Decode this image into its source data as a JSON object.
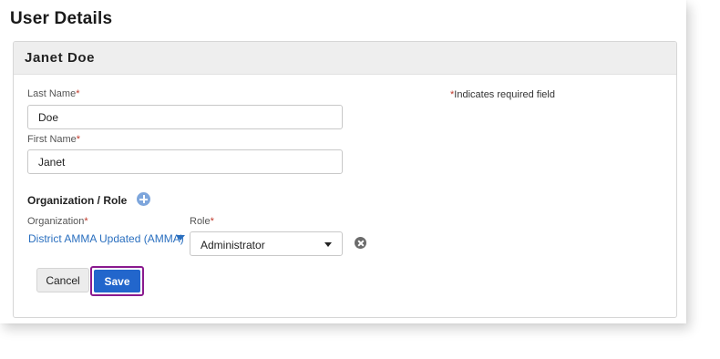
{
  "page": {
    "title": "User Details"
  },
  "card": {
    "header_name": "Janet Doe"
  },
  "form": {
    "required_asterisk": "*",
    "required_note_text": "Indicates required field",
    "last_name": {
      "label": "Last Name",
      "value": "Doe"
    },
    "first_name": {
      "label": "First Name",
      "value": "Janet"
    },
    "org_role": {
      "section_title": "Organization / Role",
      "add_icon": "plus-circle-icon",
      "organization": {
        "label": "Organization",
        "value": "District AMMA Updated (AMMA)"
      },
      "role": {
        "label": "Role",
        "value": "Administrator"
      },
      "remove_icon": "close-circle-icon"
    }
  },
  "actions": {
    "cancel_label": "Cancel",
    "save_label": "Save"
  },
  "colors": {
    "accent": "#2266cc",
    "link": "#2a6fbf",
    "required": "#c0392b",
    "focus_outline": "#8a1a8f",
    "header_bg": "#eeeeee"
  }
}
